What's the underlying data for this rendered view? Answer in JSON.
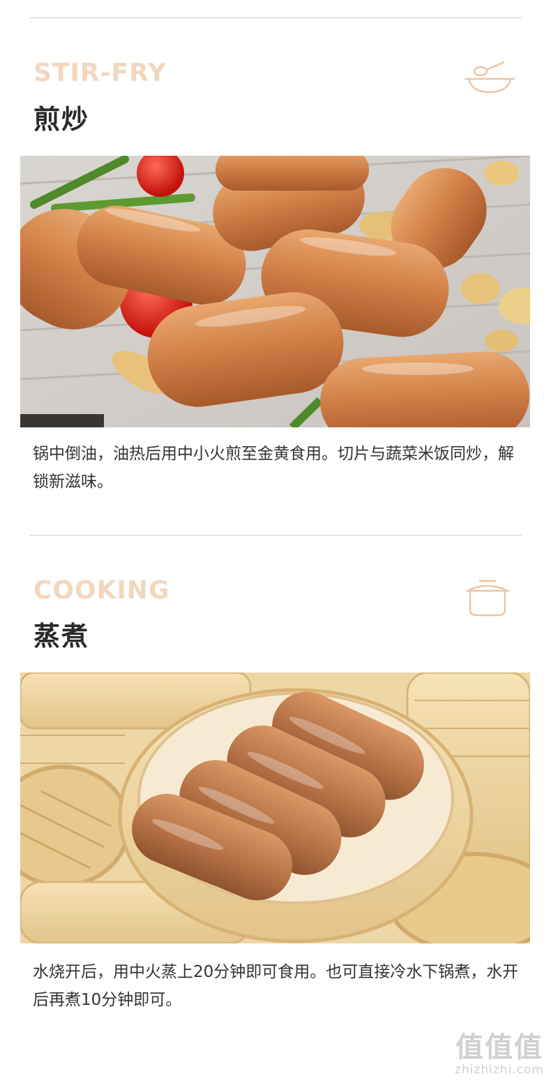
{
  "sections": [
    {
      "en_title": "STIR-FRY",
      "cn_title": "煎炒",
      "icon": "frying-pan-icon",
      "photo": "fried sausages on a grill pan with cherry tomatoes, mushrooms and asparagus",
      "description": "锅中倒油，油热后用中小火煎至金黄食用。切片与蔬菜米饭同炒，解锁新滋味。"
    },
    {
      "en_title": "COOKING",
      "cn_title": "蒸煮",
      "icon": "cooking-pot-icon",
      "photo": "sausages in a bamboo steamer",
      "description": "水烧开后，用中火蒸上20分钟即可食用。也可直接冷水下锅煮，水开后再煮10分钟即可。"
    }
  ],
  "watermark": {
    "logo": "值值值",
    "site": "zhizhizhi.com"
  },
  "colors": {
    "accent_title": "#f2d7be",
    "icon_stroke": "#e8c5a5",
    "text": "#333333"
  }
}
